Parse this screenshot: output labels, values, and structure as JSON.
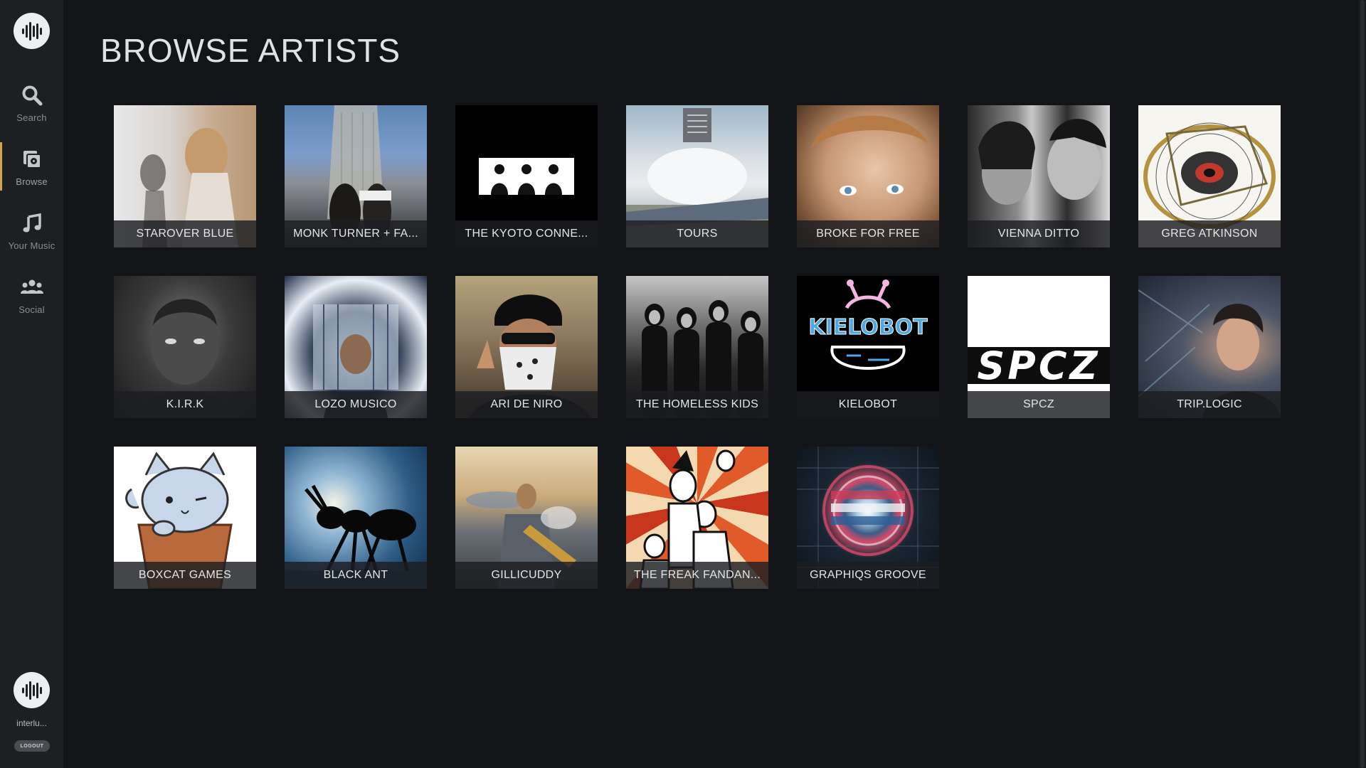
{
  "app": {
    "logo_icon": "waveform-icon",
    "accent_color": "#d2a54b"
  },
  "sidebar": {
    "items": [
      {
        "label": "Search",
        "icon": "search-icon"
      },
      {
        "label": "Browse",
        "icon": "browse-icon",
        "active": true
      },
      {
        "label": "Your Music",
        "icon": "music-note-icon"
      },
      {
        "label": "Social",
        "icon": "people-icon"
      }
    ],
    "user": {
      "name": "interlu...",
      "avatar_icon": "waveform-icon",
      "logout_label": "LOGOUT"
    }
  },
  "main": {
    "title": "BROWSE ARTISTS",
    "artists": [
      {
        "name": "STAROVER BLUE"
      },
      {
        "name": "MONK TURNER + FA..."
      },
      {
        "name": "THE KYOTO CONNE..."
      },
      {
        "name": "TOURS"
      },
      {
        "name": "BROKE FOR FREE"
      },
      {
        "name": "VIENNA DITTO"
      },
      {
        "name": "GREG ATKINSON"
      },
      {
        "name": "K.I.R.K"
      },
      {
        "name": "LOZO MUSICO"
      },
      {
        "name": "ARI DE NIRO"
      },
      {
        "name": "THE HOMELESS KIDS"
      },
      {
        "name": "KIELOBOT",
        "art_text": "KIELOBOT"
      },
      {
        "name": "SPCZ",
        "art_text": "SPCZ"
      },
      {
        "name": "TRIP.LOGIC"
      },
      {
        "name": "BOXCAT GAMES"
      },
      {
        "name": "BLACK ANT"
      },
      {
        "name": "GILLICUDDY"
      },
      {
        "name": "THE FREAK FANDAN..."
      },
      {
        "name": "GRAPHIQS GROOVE"
      }
    ]
  }
}
